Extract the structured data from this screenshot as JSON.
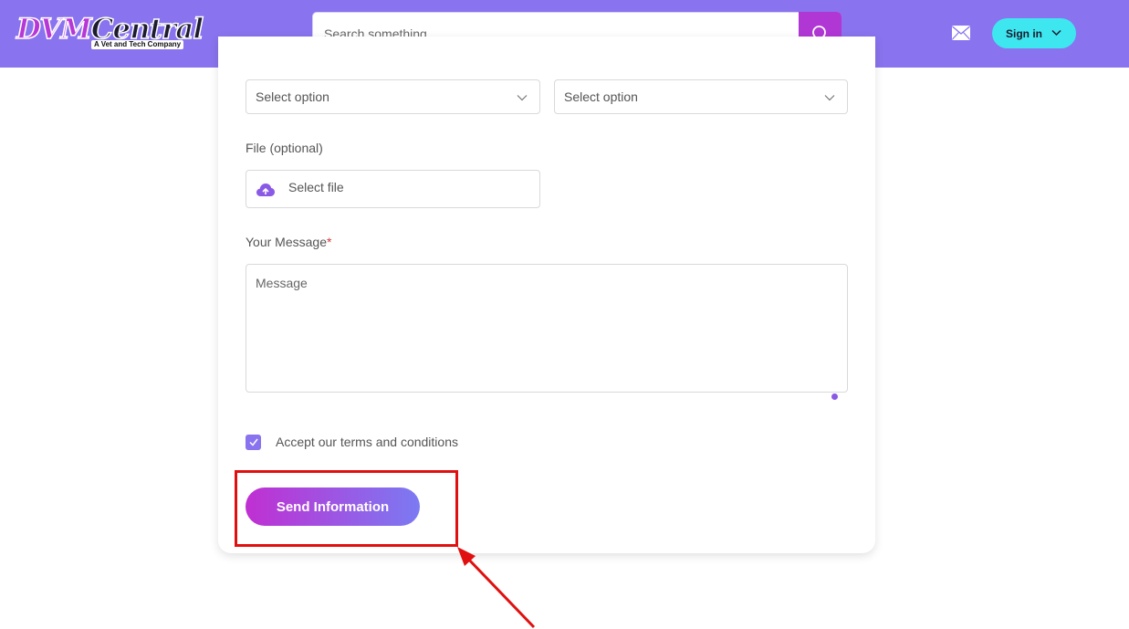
{
  "header": {
    "logo": {
      "brand_part1": "DVM",
      "brand_part2": "Central",
      "tagline": "A Vet and Tech Company"
    },
    "search": {
      "placeholder": "Search something ...",
      "icon": "search-icon"
    },
    "mail_icon": "mail-icon",
    "sign_in": {
      "label": "Sign in",
      "icon": "chevron-down-icon"
    },
    "colors": {
      "bar": "#8a73ee",
      "search_button": "#b037d4",
      "sign_in": "#3ee7ef"
    }
  },
  "form": {
    "select_left": {
      "value": "Select option"
    },
    "select_right": {
      "value": "Select option"
    },
    "file": {
      "label": "File (optional)",
      "button_text": "Select file",
      "icon": "cloud-upload-icon"
    },
    "message": {
      "label": "Your Message",
      "required_mark": "*",
      "placeholder": "Message"
    },
    "terms": {
      "label": "Accept our terms and conditions",
      "checked": true
    },
    "submit": {
      "label": "Send Information"
    }
  },
  "annotation": {
    "color": "#e01010",
    "type": "highlight-box-with-arrow"
  }
}
